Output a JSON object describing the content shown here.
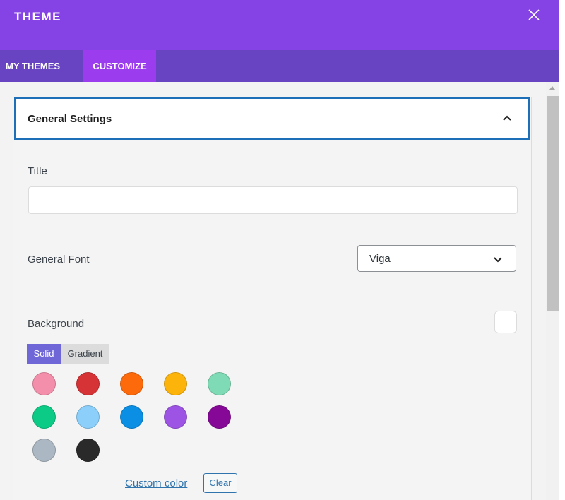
{
  "header": {
    "title": "THEME"
  },
  "tabs": [
    {
      "label": "MY THEMES",
      "active": false
    },
    {
      "label": "CUSTOMIZE",
      "active": true
    }
  ],
  "accordion": {
    "title": "General Settings",
    "expanded": true
  },
  "fields": {
    "title_label": "Title",
    "title_value": "",
    "font_label": "General Font",
    "font_value": "Viga",
    "background_label": "Background"
  },
  "background_modes": {
    "solid": "Solid",
    "gradient": "Gradient",
    "active": "Solid"
  },
  "palette": [
    "#f48fab",
    "#d63336",
    "#fd6a0c",
    "#fdb40a",
    "#7fdbb5",
    "#0ccb86",
    "#8bcffa",
    "#0a8fe4",
    "#9d53e4",
    "#850996",
    "#abb8c3",
    "#2a2a2a"
  ],
  "actions": {
    "custom_color": "Custom color",
    "clear": "Clear"
  },
  "icons": [
    "close-icon",
    "chevron-up-icon",
    "chevron-down-icon"
  ],
  "colors": {
    "header_bg": "#8542e5",
    "tabs_bg": "#6843c2",
    "active_tab_bg": "#9b3cef",
    "accent_border": "#1d6fb8",
    "solid_tab_bg": "#6f67d8",
    "link": "#2f74ad"
  }
}
